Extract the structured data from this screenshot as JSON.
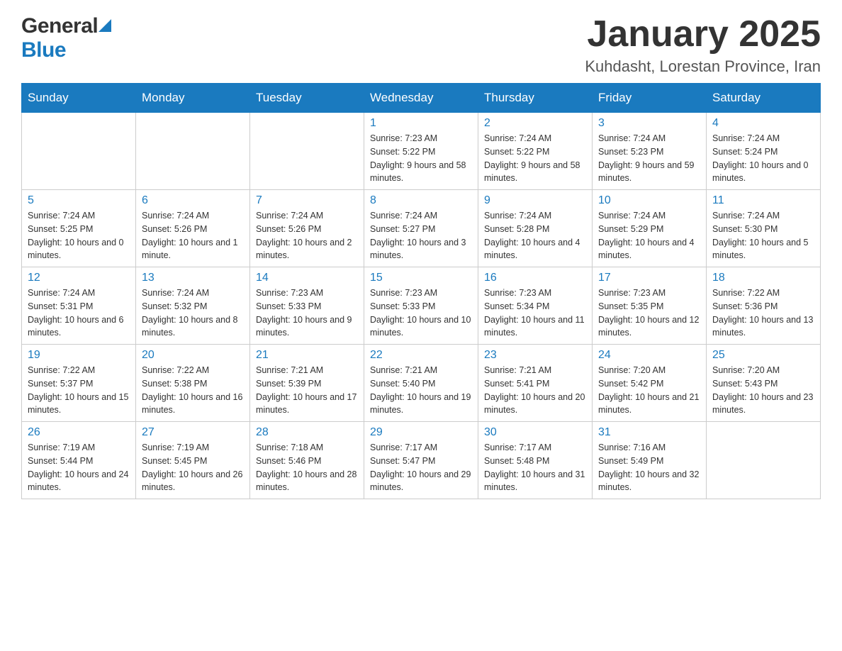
{
  "header": {
    "title": "January 2025",
    "subtitle": "Kuhdasht, Lorestan Province, Iran",
    "logo_general": "General",
    "logo_blue": "Blue"
  },
  "days_of_week": [
    "Sunday",
    "Monday",
    "Tuesday",
    "Wednesday",
    "Thursday",
    "Friday",
    "Saturday"
  ],
  "weeks": [
    [
      {
        "day": "",
        "sunrise": "",
        "sunset": "",
        "daylight": ""
      },
      {
        "day": "",
        "sunrise": "",
        "sunset": "",
        "daylight": ""
      },
      {
        "day": "",
        "sunrise": "",
        "sunset": "",
        "daylight": ""
      },
      {
        "day": "1",
        "sunrise": "Sunrise: 7:23 AM",
        "sunset": "Sunset: 5:22 PM",
        "daylight": "Daylight: 9 hours and 58 minutes."
      },
      {
        "day": "2",
        "sunrise": "Sunrise: 7:24 AM",
        "sunset": "Sunset: 5:22 PM",
        "daylight": "Daylight: 9 hours and 58 minutes."
      },
      {
        "day": "3",
        "sunrise": "Sunrise: 7:24 AM",
        "sunset": "Sunset: 5:23 PM",
        "daylight": "Daylight: 9 hours and 59 minutes."
      },
      {
        "day": "4",
        "sunrise": "Sunrise: 7:24 AM",
        "sunset": "Sunset: 5:24 PM",
        "daylight": "Daylight: 10 hours and 0 minutes."
      }
    ],
    [
      {
        "day": "5",
        "sunrise": "Sunrise: 7:24 AM",
        "sunset": "Sunset: 5:25 PM",
        "daylight": "Daylight: 10 hours and 0 minutes."
      },
      {
        "day": "6",
        "sunrise": "Sunrise: 7:24 AM",
        "sunset": "Sunset: 5:26 PM",
        "daylight": "Daylight: 10 hours and 1 minute."
      },
      {
        "day": "7",
        "sunrise": "Sunrise: 7:24 AM",
        "sunset": "Sunset: 5:26 PM",
        "daylight": "Daylight: 10 hours and 2 minutes."
      },
      {
        "day": "8",
        "sunrise": "Sunrise: 7:24 AM",
        "sunset": "Sunset: 5:27 PM",
        "daylight": "Daylight: 10 hours and 3 minutes."
      },
      {
        "day": "9",
        "sunrise": "Sunrise: 7:24 AM",
        "sunset": "Sunset: 5:28 PM",
        "daylight": "Daylight: 10 hours and 4 minutes."
      },
      {
        "day": "10",
        "sunrise": "Sunrise: 7:24 AM",
        "sunset": "Sunset: 5:29 PM",
        "daylight": "Daylight: 10 hours and 4 minutes."
      },
      {
        "day": "11",
        "sunrise": "Sunrise: 7:24 AM",
        "sunset": "Sunset: 5:30 PM",
        "daylight": "Daylight: 10 hours and 5 minutes."
      }
    ],
    [
      {
        "day": "12",
        "sunrise": "Sunrise: 7:24 AM",
        "sunset": "Sunset: 5:31 PM",
        "daylight": "Daylight: 10 hours and 6 minutes."
      },
      {
        "day": "13",
        "sunrise": "Sunrise: 7:24 AM",
        "sunset": "Sunset: 5:32 PM",
        "daylight": "Daylight: 10 hours and 8 minutes."
      },
      {
        "day": "14",
        "sunrise": "Sunrise: 7:23 AM",
        "sunset": "Sunset: 5:33 PM",
        "daylight": "Daylight: 10 hours and 9 minutes."
      },
      {
        "day": "15",
        "sunrise": "Sunrise: 7:23 AM",
        "sunset": "Sunset: 5:33 PM",
        "daylight": "Daylight: 10 hours and 10 minutes."
      },
      {
        "day": "16",
        "sunrise": "Sunrise: 7:23 AM",
        "sunset": "Sunset: 5:34 PM",
        "daylight": "Daylight: 10 hours and 11 minutes."
      },
      {
        "day": "17",
        "sunrise": "Sunrise: 7:23 AM",
        "sunset": "Sunset: 5:35 PM",
        "daylight": "Daylight: 10 hours and 12 minutes."
      },
      {
        "day": "18",
        "sunrise": "Sunrise: 7:22 AM",
        "sunset": "Sunset: 5:36 PM",
        "daylight": "Daylight: 10 hours and 13 minutes."
      }
    ],
    [
      {
        "day": "19",
        "sunrise": "Sunrise: 7:22 AM",
        "sunset": "Sunset: 5:37 PM",
        "daylight": "Daylight: 10 hours and 15 minutes."
      },
      {
        "day": "20",
        "sunrise": "Sunrise: 7:22 AM",
        "sunset": "Sunset: 5:38 PM",
        "daylight": "Daylight: 10 hours and 16 minutes."
      },
      {
        "day": "21",
        "sunrise": "Sunrise: 7:21 AM",
        "sunset": "Sunset: 5:39 PM",
        "daylight": "Daylight: 10 hours and 17 minutes."
      },
      {
        "day": "22",
        "sunrise": "Sunrise: 7:21 AM",
        "sunset": "Sunset: 5:40 PM",
        "daylight": "Daylight: 10 hours and 19 minutes."
      },
      {
        "day": "23",
        "sunrise": "Sunrise: 7:21 AM",
        "sunset": "Sunset: 5:41 PM",
        "daylight": "Daylight: 10 hours and 20 minutes."
      },
      {
        "day": "24",
        "sunrise": "Sunrise: 7:20 AM",
        "sunset": "Sunset: 5:42 PM",
        "daylight": "Daylight: 10 hours and 21 minutes."
      },
      {
        "day": "25",
        "sunrise": "Sunrise: 7:20 AM",
        "sunset": "Sunset: 5:43 PM",
        "daylight": "Daylight: 10 hours and 23 minutes."
      }
    ],
    [
      {
        "day": "26",
        "sunrise": "Sunrise: 7:19 AM",
        "sunset": "Sunset: 5:44 PM",
        "daylight": "Daylight: 10 hours and 24 minutes."
      },
      {
        "day": "27",
        "sunrise": "Sunrise: 7:19 AM",
        "sunset": "Sunset: 5:45 PM",
        "daylight": "Daylight: 10 hours and 26 minutes."
      },
      {
        "day": "28",
        "sunrise": "Sunrise: 7:18 AM",
        "sunset": "Sunset: 5:46 PM",
        "daylight": "Daylight: 10 hours and 28 minutes."
      },
      {
        "day": "29",
        "sunrise": "Sunrise: 7:17 AM",
        "sunset": "Sunset: 5:47 PM",
        "daylight": "Daylight: 10 hours and 29 minutes."
      },
      {
        "day": "30",
        "sunrise": "Sunrise: 7:17 AM",
        "sunset": "Sunset: 5:48 PM",
        "daylight": "Daylight: 10 hours and 31 minutes."
      },
      {
        "day": "31",
        "sunrise": "Sunrise: 7:16 AM",
        "sunset": "Sunset: 5:49 PM",
        "daylight": "Daylight: 10 hours and 32 minutes."
      },
      {
        "day": "",
        "sunrise": "",
        "sunset": "",
        "daylight": ""
      }
    ]
  ]
}
